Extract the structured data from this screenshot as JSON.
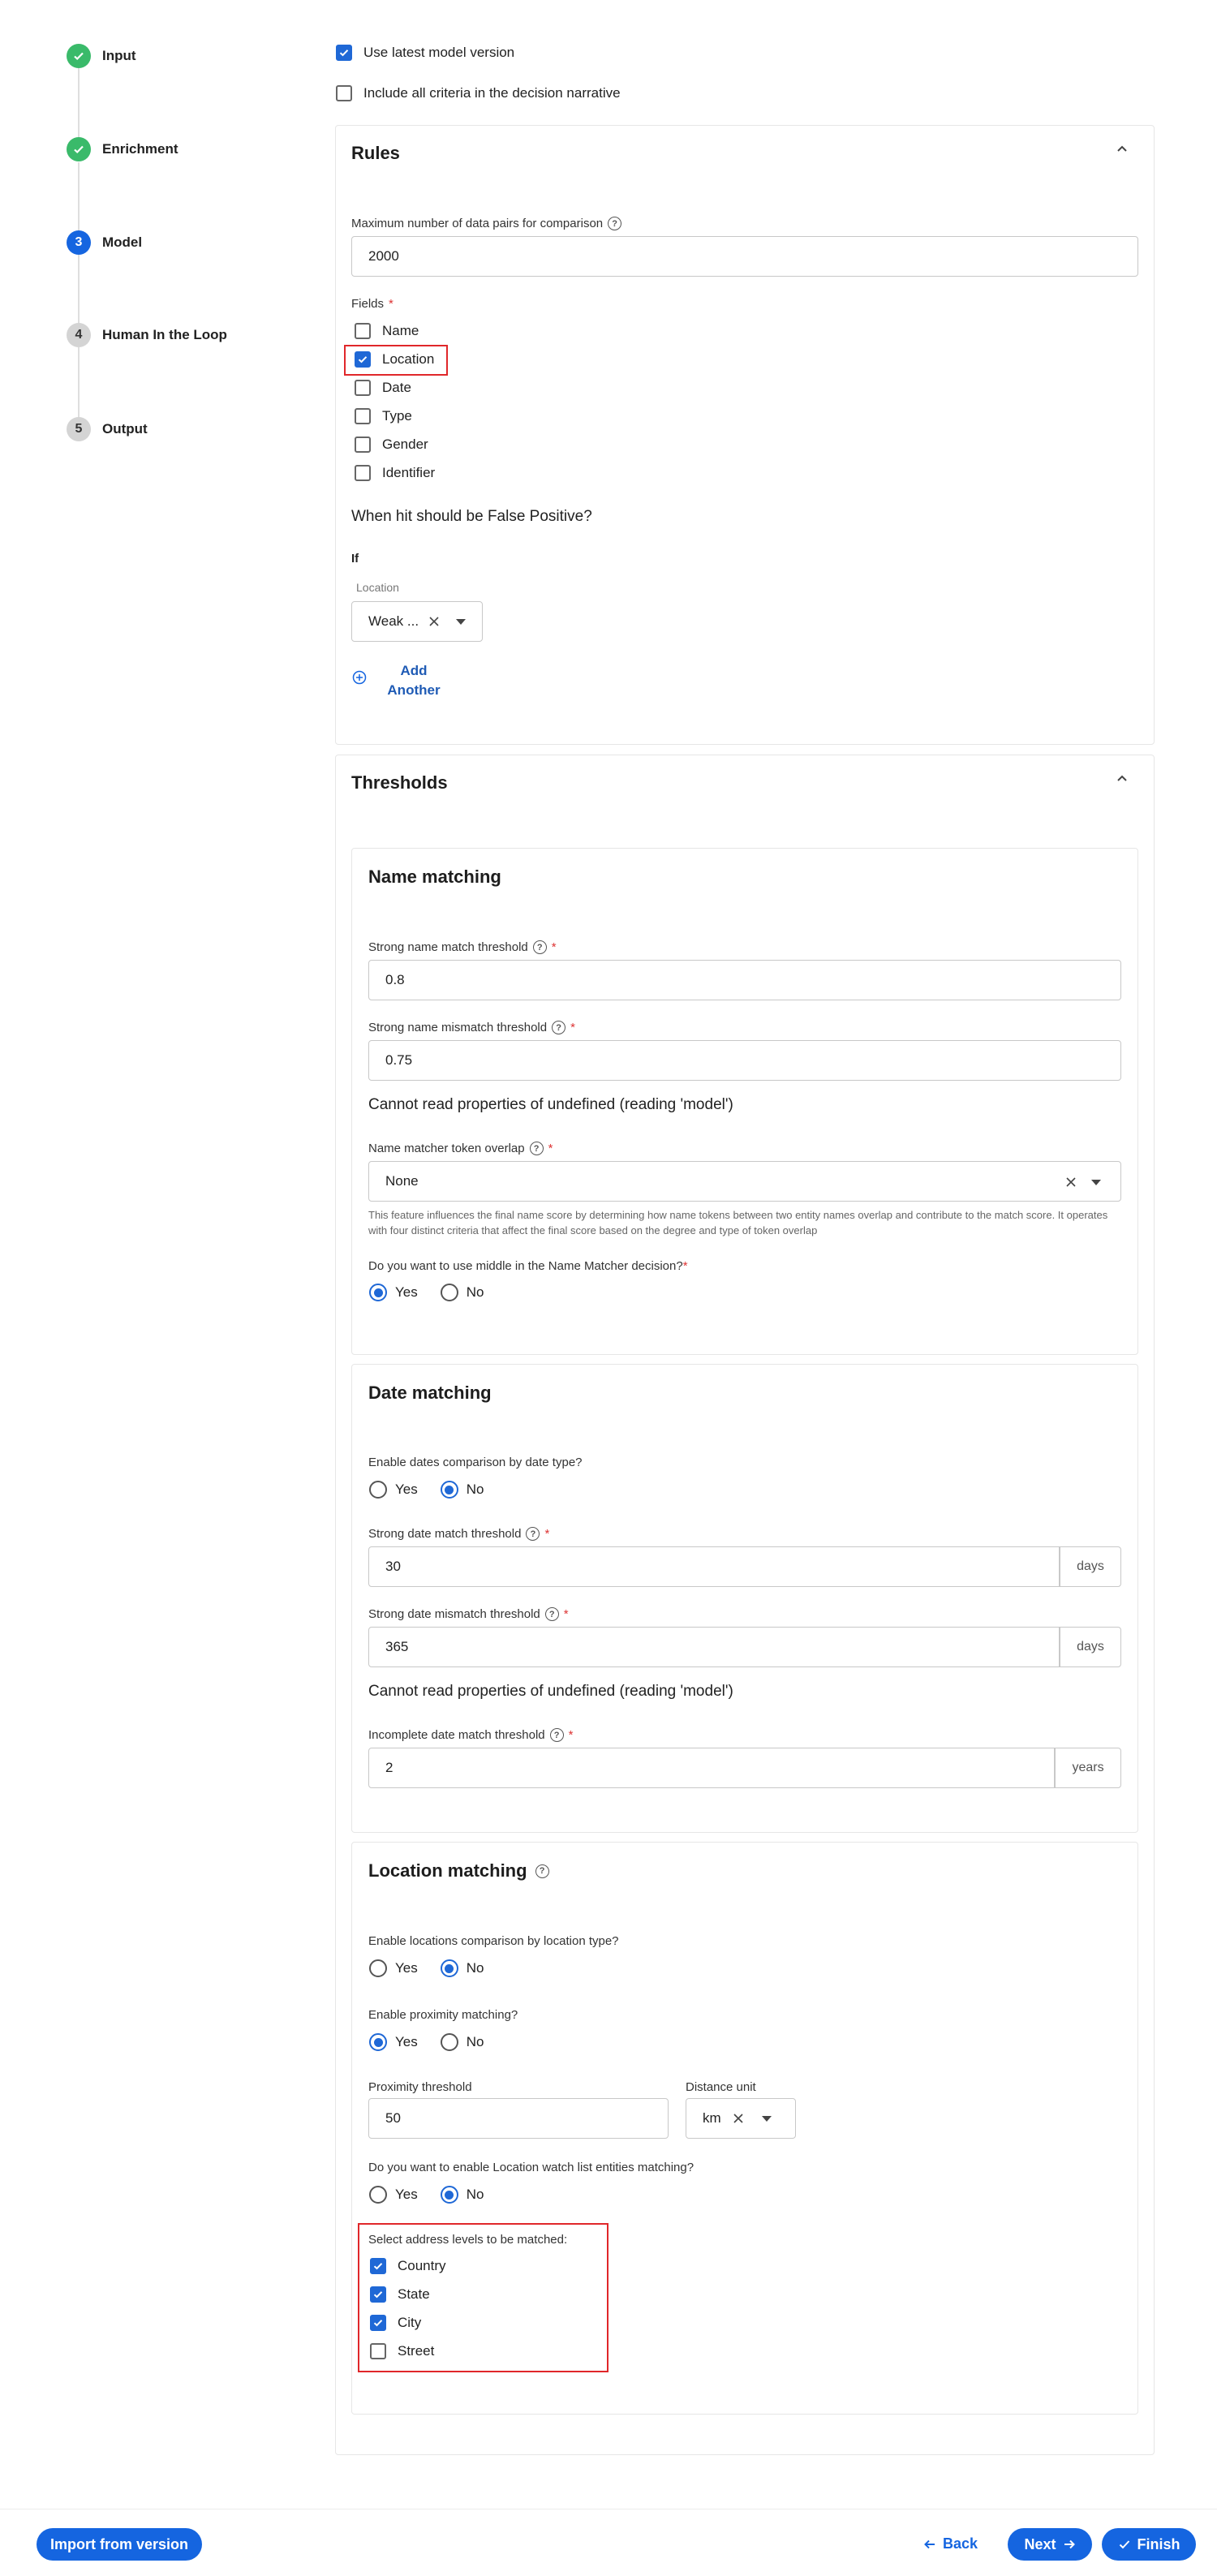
{
  "stepper": [
    {
      "label": "Input",
      "num": "",
      "state": "done"
    },
    {
      "label": "Enrichment",
      "num": "",
      "state": "done"
    },
    {
      "label": "Model",
      "num": "3",
      "state": "active"
    },
    {
      "label": "Human In the Loop",
      "num": "4",
      "state": "todo"
    },
    {
      "label": "Output",
      "num": "5",
      "state": "todo"
    }
  ],
  "top_options": {
    "latest_model": "Use latest model version",
    "include_criteria": "Include all criteria in the decision narrative"
  },
  "rules": {
    "title": "Rules",
    "max_pairs_label": "Maximum number of data pairs for comparison",
    "max_pairs_value": "2000",
    "fields_label": "Fields",
    "fields": [
      {
        "label": "Name",
        "checked": false
      },
      {
        "label": "Location",
        "checked": true
      },
      {
        "label": "Date",
        "checked": false
      },
      {
        "label": "Type",
        "checked": false
      },
      {
        "label": "Gender",
        "checked": false
      },
      {
        "label": "Identifier",
        "checked": false
      }
    ],
    "false_positive_question": "When hit should be False Positive?",
    "if_label": "If",
    "location_label": "Location",
    "location_value": "Weak ...",
    "add_another": [
      "Add",
      "Another"
    ]
  },
  "thresholds": {
    "title": "Thresholds",
    "name_matching": {
      "title": "Name matching",
      "strong_match_label": "Strong name match threshold",
      "strong_match_value": "0.8",
      "strong_mismatch_label": "Strong name mismatch threshold",
      "strong_mismatch_value": "0.75",
      "error": "Cannot read properties of undefined (reading 'model')",
      "token_overlap_label": "Name matcher token overlap",
      "token_overlap_value": "None",
      "token_help": "This feature influences the final name score by determining how name tokens between two entity names overlap and contribute to the match score. It operates with four distinct criteria that affect the final score based on the degree and type of token overlap",
      "middle_question": "Do you want to use middle in the Name Matcher decision?",
      "yes": "Yes",
      "no": "No",
      "middle_selected": "yes"
    },
    "date_matching": {
      "title": "Date matching",
      "by_type_question": "Enable dates comparison by date type?",
      "by_type_selected": "no",
      "strong_match_label": "Strong date match threshold",
      "strong_match_value": "30",
      "strong_match_unit": "days",
      "strong_mismatch_label": "Strong date mismatch threshold",
      "strong_mismatch_value": "365",
      "strong_mismatch_unit": "days",
      "error": "Cannot read properties of undefined (reading 'model')",
      "incomplete_label": "Incomplete date match threshold",
      "incomplete_value": "2",
      "incomplete_unit": "years",
      "yes": "Yes",
      "no": "No"
    },
    "location_matching": {
      "title": "Location matching",
      "by_type_question": "Enable locations comparison by location type?",
      "by_type_selected": "no",
      "proximity_question": "Enable proximity matching?",
      "proximity_selected": "yes",
      "proximity_threshold_label": "Proximity threshold",
      "proximity_threshold_value": "50",
      "distance_unit_label": "Distance unit",
      "distance_unit_value": "km",
      "watchlist_question": "Do you want to enable Location watch list entities matching?",
      "watchlist_selected": "no",
      "address_levels_label": "Select address levels to be matched:",
      "address_levels": [
        {
          "label": "Country",
          "checked": true
        },
        {
          "label": "State",
          "checked": true
        },
        {
          "label": "City",
          "checked": true
        },
        {
          "label": "Street",
          "checked": false
        }
      ],
      "yes": "Yes",
      "no": "No"
    }
  },
  "footer": {
    "import": "Import from version",
    "back": "Back",
    "next": "Next",
    "finish": "Finish"
  },
  "colors": {
    "primary": "#1565e0",
    "success": "#3aba6a",
    "highlight": "#e0272a"
  }
}
